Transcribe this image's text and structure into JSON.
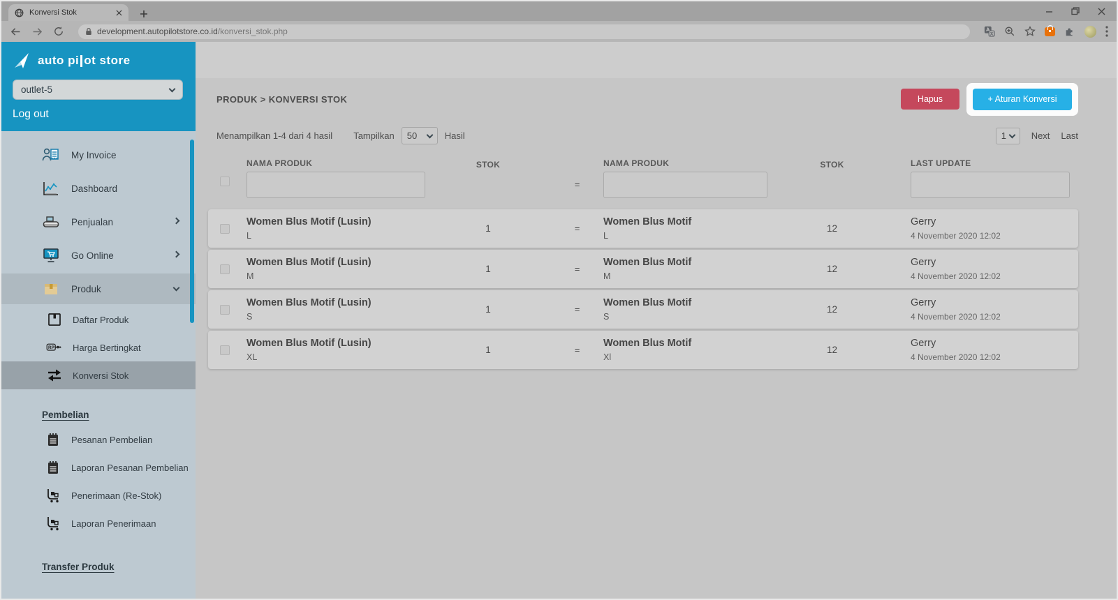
{
  "browser": {
    "tab_title": "Konversi Stok",
    "url_domain": "development.autopilotstore.co.id",
    "url_path": "/konversi_stok.php"
  },
  "sidebar": {
    "brand_prefix": "auto pi",
    "brand_suffix": "ot store",
    "outlet_value": "outlet-5",
    "logout_label": "Log out",
    "menu": [
      {
        "label": "My Invoice"
      },
      {
        "label": "Dashboard"
      },
      {
        "label": "Penjualan"
      },
      {
        "label": "Go Online"
      },
      {
        "label": "Produk"
      }
    ],
    "produk_submenu": [
      {
        "label": "Daftar Produk"
      },
      {
        "label": "Harga Bertingkat"
      },
      {
        "label": "Konversi Stok"
      }
    ],
    "section_pembelian": "Pembelian",
    "pembelian_items": [
      {
        "label": "Pesanan Pembelian"
      },
      {
        "label": "Laporan Pesanan Pembelian"
      },
      {
        "label": "Penerimaan (Re-Stok)"
      },
      {
        "label": "Laporan Penerimaan"
      }
    ],
    "section_transfer": "Transfer Produk"
  },
  "main": {
    "breadcrumb": "PRODUK > KONVERSI STOK",
    "hapus_label": "Hapus",
    "add_rule_label": "+ Aturan Konversi",
    "showing_text": "Menampilkan 1-4 dari 4 hasil",
    "tampilkan_label": "Tampilkan",
    "per_page_value": "50",
    "hasil_label": "Hasil",
    "page_value": "1",
    "next_label": "Next",
    "last_label": "Last",
    "table": {
      "col_nama_produk_1": "NAMA PRODUK",
      "col_stok_1": "STOK",
      "equals": "=",
      "col_nama_produk_2": "NAMA PRODUK",
      "col_stok_2": "STOK",
      "col_last_update": "LAST UPDATE"
    },
    "rows": [
      {
        "left_name": "Women Blus Motif (Lusin)",
        "left_variant": "L",
        "left_stok": "1",
        "eq": "=",
        "right_name": "Women Blus Motif",
        "right_variant": "L",
        "right_stok": "12",
        "updated_by": "Gerry",
        "updated_at": "4 November 2020 12:02"
      },
      {
        "left_name": "Women Blus Motif (Lusin)",
        "left_variant": "M",
        "left_stok": "1",
        "eq": "=",
        "right_name": "Women Blus Motif",
        "right_variant": "M",
        "right_stok": "12",
        "updated_by": "Gerry",
        "updated_at": "4 November 2020 12:02"
      },
      {
        "left_name": "Women Blus Motif (Lusin)",
        "left_variant": "S",
        "left_stok": "1",
        "eq": "=",
        "right_name": "Women Blus Motif",
        "right_variant": "S",
        "right_stok": "12",
        "updated_by": "Gerry",
        "updated_at": "4 November 2020 12:02"
      },
      {
        "left_name": "Women Blus Motif (Lusin)",
        "left_variant": "XL",
        "left_stok": "1",
        "eq": "=",
        "right_name": "Women Blus Motif",
        "right_variant": "Xl",
        "right_stok": "12",
        "updated_by": "Gerry",
        "updated_at": "4 November 2020 12:02"
      }
    ]
  },
  "colors": {
    "sidebar_teal": "#1794c1",
    "add_button_cyan": "#27b0e6",
    "delete_button_red": "#c5485c",
    "spotlight_white": "#fcfcfc"
  }
}
